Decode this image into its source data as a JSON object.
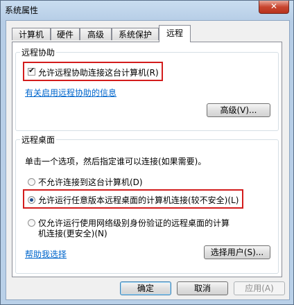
{
  "window": {
    "title": "系统属性",
    "close_label": "✕"
  },
  "tabs": [
    {
      "label": "计算机名"
    },
    {
      "label": "硬件"
    },
    {
      "label": "高级"
    },
    {
      "label": "系统保护"
    },
    {
      "label": "远程",
      "active": true
    }
  ],
  "remote_assistance": {
    "group_title": "远程协助",
    "allow_label": "允许远程协助连接这台计算机(R)",
    "allow_checked": true,
    "info_link": "有关启用远程协助的信息",
    "advanced_button": "高级(V)..."
  },
  "remote_desktop": {
    "group_title": "远程桌面",
    "instruction": "单击一个选项，然后指定谁可以连接(如果需要)。",
    "options": [
      {
        "label": "不允许连接到这台计算机(D)",
        "selected": false
      },
      {
        "label": "允许运行任意版本远程桌面的计算机连接(较不安全)(L)",
        "selected": true
      },
      {
        "label_line1": "仅允许运行使用网络级别身份验证的远程桌面的计算",
        "label_line2": "机连接(更安全)(N)",
        "selected": false
      }
    ],
    "help_link": "帮助我选择",
    "select_users_button": "选择用户(S)..."
  },
  "footer": {
    "ok": "确定",
    "cancel": "取消",
    "apply": "应用(A)"
  },
  "colors": {
    "highlight": "#d31c1c",
    "link": "#0066cc"
  }
}
